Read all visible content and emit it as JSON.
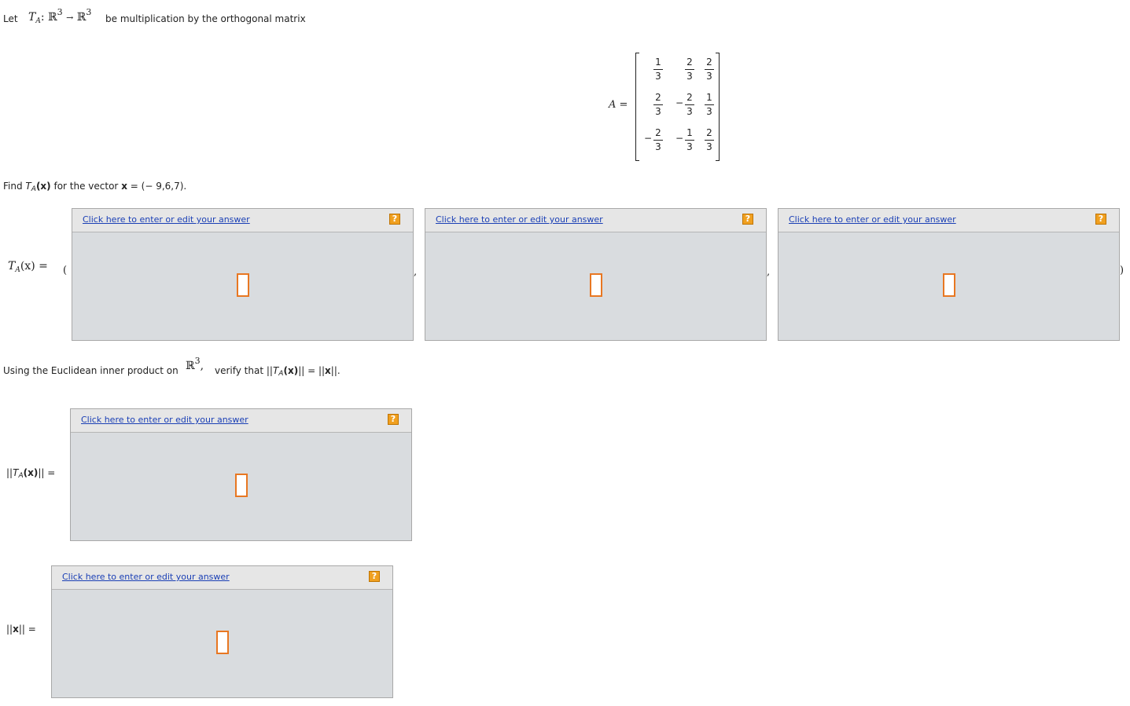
{
  "intro": {
    "let": "Let",
    "map_T": "T",
    "map_sub": "A",
    "map_colon": ":",
    "domain": "ℝ",
    "domain_exp": "3",
    "arrow": "→",
    "codomain": "ℝ",
    "codomain_exp": "3",
    "text": "be multiplication by the orthogonal matrix"
  },
  "matrix": {
    "label": "A =",
    "rows": [
      [
        {
          "sign": "",
          "num": "1",
          "den": "3"
        },
        {
          "sign": "",
          "num": "2",
          "den": "3"
        },
        {
          "sign": "",
          "num": "2",
          "den": "3"
        }
      ],
      [
        {
          "sign": "",
          "num": "2",
          "den": "3"
        },
        {
          "sign": "−",
          "num": "2",
          "den": "3"
        },
        {
          "sign": "",
          "num": "1",
          "den": "3"
        }
      ],
      [
        {
          "sign": "−",
          "num": "2",
          "den": "3"
        },
        {
          "sign": "−",
          "num": "1",
          "den": "3"
        },
        {
          "sign": "",
          "num": "2",
          "den": "3"
        }
      ]
    ]
  },
  "question1": {
    "find": "Find",
    "T": "T",
    "T_sub": "A",
    "x_paren": "(x)",
    "for_vector": "for the vector",
    "x": "x",
    "vector": "= (− 9,6,7)."
  },
  "result_row": {
    "lhs_T": "T",
    "lhs_sub": "A",
    "lhs_arg": "(x) =",
    "open_paren": "(",
    "comma": ",",
    "close_paren": ")"
  },
  "answer_boxes": [
    {
      "link": "Click here to enter or edit your answer",
      "help": "?"
    },
    {
      "link": "Click here to enter or edit your answer",
      "help": "?"
    },
    {
      "link": "Click here to enter or edit your answer",
      "help": "?"
    },
    {
      "link": "Click here to enter or edit your answer",
      "help": "?"
    },
    {
      "link": "Click here to enter or edit your answer",
      "help": "?"
    }
  ],
  "question2": {
    "text_before": "Using the Euclidean inner product on",
    "space": "ℝ",
    "space_exp": "3",
    "space_comma": ",",
    "text_after_1": "verify that ||",
    "T": "T",
    "T_sub": "A",
    "x_bold": "(x)",
    "text_after_2": "|| = ||",
    "x": "x",
    "text_after_3": "||."
  },
  "norm_T_label": {
    "bars_left": "||",
    "T": "T",
    "T_sub": "A",
    "arg": "(x)",
    "bars_right": "|| ="
  },
  "norm_x_label": {
    "bars_left": "||",
    "x": "x",
    "bars_right": "|| ="
  }
}
